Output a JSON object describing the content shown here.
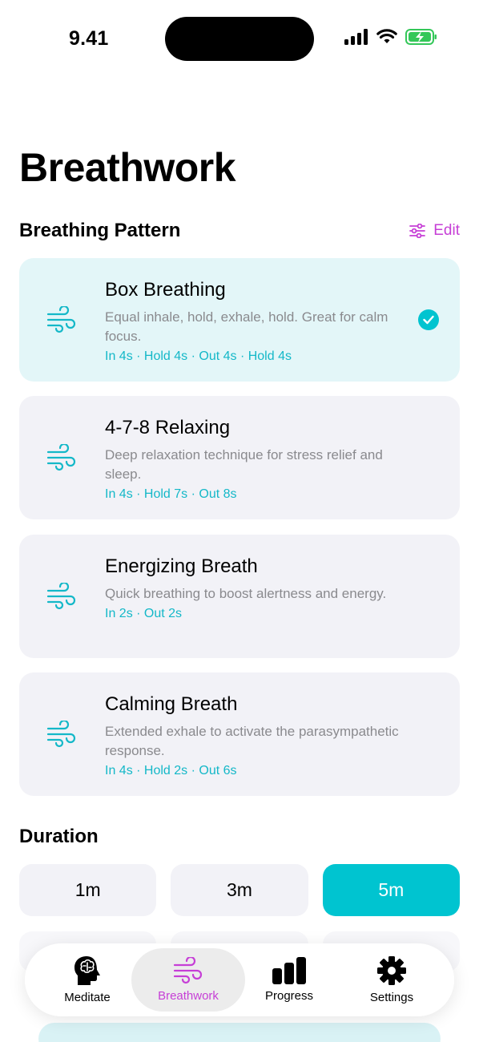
{
  "status_bar": {
    "time": "9.41"
  },
  "page": {
    "title": "Breathwork"
  },
  "pattern_section": {
    "title": "Breathing Pattern",
    "edit_label": "Edit"
  },
  "patterns": [
    {
      "name": "Box Breathing",
      "description": "Equal inhale, hold, exhale, hold. Great for calm focus.",
      "timing": "In 4s · Hold 4s · Out 4s · Hold 4s",
      "selected": true
    },
    {
      "name": "4-7-8 Relaxing",
      "description": "Deep relaxation technique for stress relief and sleep.",
      "timing": "In 4s · Hold 7s · Out 8s",
      "selected": false
    },
    {
      "name": "Energizing Breath",
      "description": "Quick breathing to boost alertness and energy.",
      "timing": "In 2s · Out 2s",
      "selected": false
    },
    {
      "name": "Calming Breath",
      "description": "Extended exhale to activate the parasympathetic response.",
      "timing": "In 4s · Hold 2s · Out 6s",
      "selected": false
    }
  ],
  "duration_section": {
    "title": "Duration"
  },
  "durations": [
    {
      "label": "1m",
      "selected": false
    },
    {
      "label": "3m",
      "selected": false
    },
    {
      "label": "5m",
      "selected": true
    }
  ],
  "tabs": [
    {
      "label": "Meditate",
      "icon": "head-brain-icon",
      "active": false
    },
    {
      "label": "Breathwork",
      "icon": "wind-icon",
      "active": true
    },
    {
      "label": "Progress",
      "icon": "bar-chart-icon",
      "active": false
    },
    {
      "label": "Settings",
      "icon": "gear-icon",
      "active": false
    }
  ],
  "colors": {
    "accent": "#00c4d0",
    "tab_active": "#c63fd6",
    "card_bg": "#f2f2f7",
    "card_selected_bg": "#e3f6f8"
  }
}
